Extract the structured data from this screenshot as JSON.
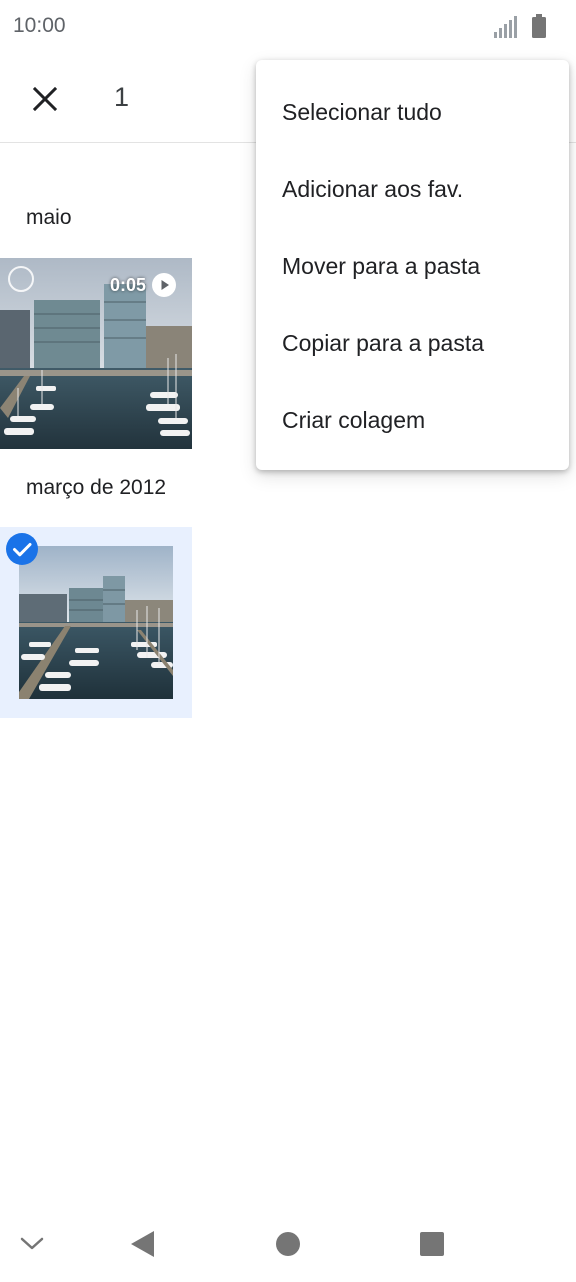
{
  "status_bar": {
    "time": "10:00",
    "icons": [
      "signal-icon",
      "battery-icon"
    ]
  },
  "app_bar": {
    "close_icon": "close-icon",
    "selected_count": "1"
  },
  "sections": [
    {
      "title": "maio",
      "items": [
        {
          "type": "video",
          "duration": "0:05",
          "selected": false
        }
      ]
    },
    {
      "title": "março de 2012",
      "items": [
        {
          "type": "photo",
          "selected": true
        }
      ]
    }
  ],
  "menu": {
    "items": [
      {
        "label": "Selecionar tudo"
      },
      {
        "label": "Adicionar aos fav."
      },
      {
        "label": "Mover para a pasta"
      },
      {
        "label": "Copiar para a pasta"
      },
      {
        "label": "Criar colagem"
      }
    ]
  },
  "nav_bar": {
    "icons": [
      "chevron-down-icon",
      "back-icon",
      "home-icon",
      "recents-icon"
    ]
  },
  "colors": {
    "accent": "#1a73e8",
    "selected_background": "#e8f0fe"
  }
}
